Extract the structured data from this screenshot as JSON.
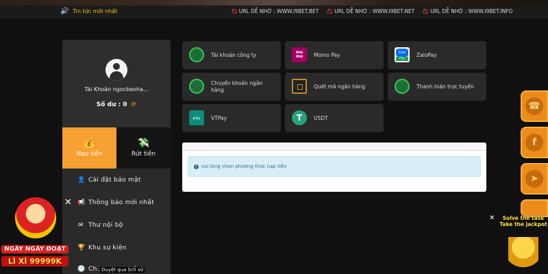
{
  "ticker": {
    "news_label": "Tin tức mới nhất",
    "urls": [
      {
        "tag": "🚫",
        "text": "URL DỄ NHỚ :  WWW.I9BET.BET"
      },
      {
        "tag": "🚫",
        "text": "URL DỄ NHỚ :  WWW.I9BET.NET"
      },
      {
        "tag": "🚫",
        "text": "URL DỄ NHỚ :  WWW.I9BET.INFO"
      }
    ]
  },
  "profile": {
    "account_label": "Tài Khoản ngocbeoha...",
    "balance_label": "Số dư :",
    "balance_value": "0"
  },
  "tabs": {
    "deposit": "Nạp tiền",
    "withdraw": "Rút tiền"
  },
  "menu": {
    "security": "Cài đặt bảo mật",
    "notifications": "Thông báo mới nhất",
    "inbox": "Thư nội bộ",
    "events": "Khu sự kiện",
    "history": "Ch...",
    "history_tail": "ch"
  },
  "payments": [
    {
      "label": "Tài khoản công ty",
      "icon": "globe-icon"
    },
    {
      "label": "Momo Pay",
      "icon": "momo-icon"
    },
    {
      "label": "ZaloPay",
      "icon": "zalopay-icon"
    },
    {
      "label": "Chuyển khoản ngân hàng",
      "icon": "globe-icon"
    },
    {
      "label": "Quét mã ngân hàng",
      "icon": "qr-icon"
    },
    {
      "label": "Thanh toán trực tuyến",
      "icon": "globe-icon"
    },
    {
      "label": "VTPay",
      "icon": "vtpay-icon"
    },
    {
      "label": "USDT",
      "icon": "usdt-icon"
    }
  ],
  "icon_text": {
    "momo_top": "mo",
    "momo_bottom": "mo",
    "zalo": "Zalo",
    "zalo_pay": "Pay",
    "vtpay": "pay",
    "usdt": "T"
  },
  "alert": {
    "text": "vui lòng chọn phương thức nạp tiền"
  },
  "promo_left": {
    "line1": "NGÀY NGÀY ĐOẠT",
    "line2": "LÌ XÌ 99999K"
  },
  "promo_right": {
    "text": "Solve the task Take the jackpot"
  },
  "tooltip": {
    "text": "Duyệt qua lịch sử"
  },
  "colors": {
    "accent": "#f5a031",
    "ticker_highlight": "#f5c400"
  }
}
